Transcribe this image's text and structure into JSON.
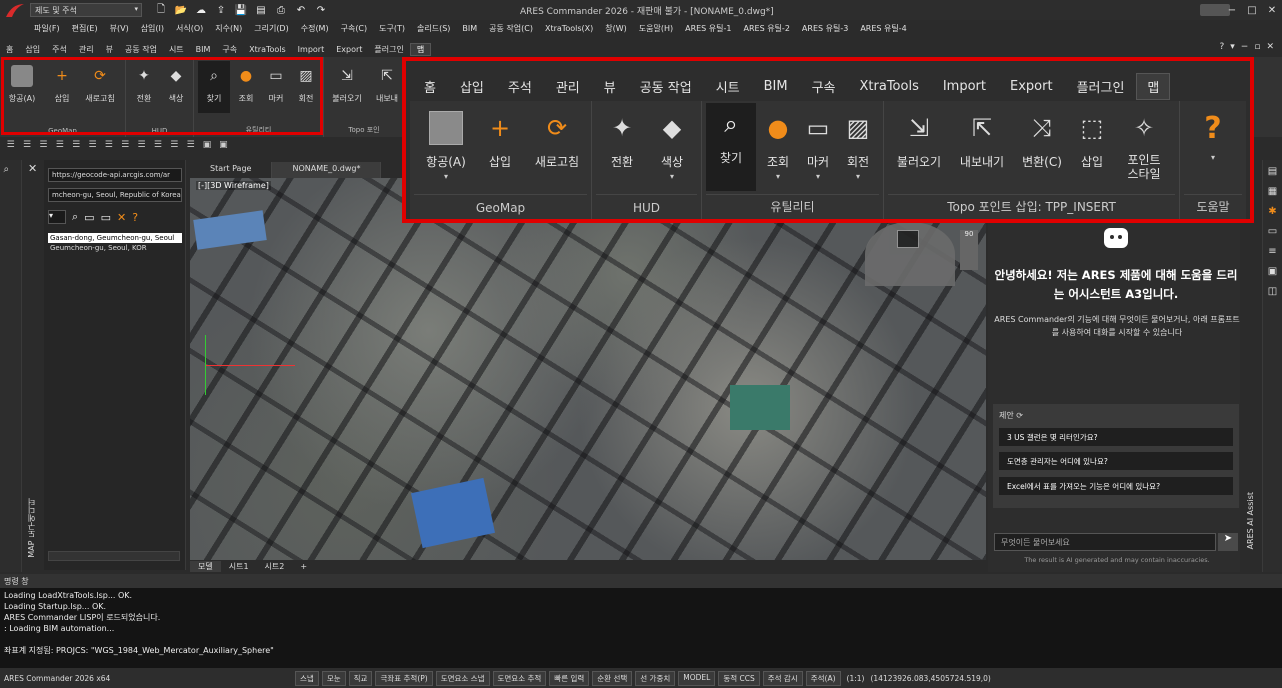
{
  "titlebar": {
    "workspace": "제도 및 주석",
    "title": "ARES Commander 2026 - 재판매 불가 - [NONAME_0.dwg*]",
    "minimize": "−",
    "maximize": "□",
    "close": "✕"
  },
  "menu": [
    "파일(F)",
    "편집(E)",
    "뷰(V)",
    "삽입(I)",
    "서식(O)",
    "지수(N)",
    "그리기(D)",
    "수정(M)",
    "구속(C)",
    "도구(T)",
    "솔리드(S)",
    "BIM",
    "공동 작업(C)",
    "XtraTools(X)",
    "창(W)",
    "도움말(H)",
    "ARES 유틸-1",
    "ARES 유틸-2",
    "ARES 유틸-3",
    "ARES 유틸-4"
  ],
  "ribbon_tabs": [
    "홈",
    "삽입",
    "주석",
    "관리",
    "뷰",
    "공동 작업",
    "시트",
    "BIM",
    "구속",
    "XtraTools",
    "Import",
    "Export",
    "플러그인",
    "맵"
  ],
  "ribbon_active": "맵",
  "small_ribbon": {
    "buttons": [
      "항공(A)",
      "삽입",
      "새로고침",
      "전환",
      "색상",
      "찾기",
      "조회",
      "마커",
      "회전",
      "불러오기",
      "내보내"
    ],
    "groups": [
      "GeoMap",
      "HUD",
      "유틸리티",
      "Topo 포인"
    ]
  },
  "zoomed_ribbon": {
    "tabs": [
      "홈",
      "삽입",
      "주석",
      "관리",
      "뷰",
      "공동 작업",
      "시트",
      "BIM",
      "구속",
      "XtraTools",
      "Import",
      "Export",
      "플러그인",
      "맵"
    ],
    "geomap": {
      "label": "GeoMap",
      "buttons": [
        "항공(A)",
        "삽입",
        "새로고침"
      ]
    },
    "hud": {
      "label": "HUD",
      "buttons": [
        "전환",
        "색상"
      ]
    },
    "utility": {
      "label": "유틸리티",
      "buttons": [
        "찾기",
        "조회",
        "마커",
        "회전"
      ]
    },
    "topo": {
      "label": "Topo 포인트 삽입: TPP_INSERT",
      "buttons": [
        "불러오기",
        "내보내기",
        "변환(C)",
        "삽입",
        "포인트\n스타일"
      ]
    },
    "help": {
      "label": "도움말"
    }
  },
  "map_panel": {
    "url": "https://geocode-api.arcgis.com/ar",
    "address": "mcheon-gu, Seoul, Republic of Korea",
    "results": [
      "Gasan-dong, Geumcheon-gu, Seoul",
      "Geumcheon-gu, Seoul, KOR"
    ],
    "vertical_label": "MAP 도구에디터"
  },
  "doc_tabs": [
    "Start Page",
    "NONAME_0.dwg*"
  ],
  "viewport_label": "[-][3D Wireframe]",
  "nav_90": "90",
  "sheet_tabs": [
    "모델",
    "시트1",
    "시트2",
    "+"
  ],
  "ai": {
    "heading": "안녕하세요! 저는 ARES 제품에 대해 도움을 드리는 어시스턴트 A3입니다.",
    "sub": "ARES Commander의 기능에 대해 무엇이든 물어보거나, 아래 프롬프트를 사용하여 대화를 시작할 수 있습니다",
    "suggest_title": "제안",
    "suggestions": [
      "3 US 갤런은 몇 리터인가요?",
      "도면층 관리자는 어디에 있나요?",
      "Excel에서 표를 가져오는 기능은 어디에 있나요?"
    ],
    "input_placeholder": "무엇이든 물어보세요",
    "disclaimer": "The result is AI generated and may contain inaccuracies.",
    "vertical_label": "ARES AI Assist"
  },
  "cmd": {
    "title": "명령 창",
    "lines": [
      "Loading LoadXtraTools.lsp... OK.",
      "Loading Startup.lsp... OK.",
      "ARES Commander LISP이 로드되었습니다.",
      ": Loading BIM automation...",
      "좌표계 지정됨: PROJCS: \"WGS_1984_Web_Mercator_Auxiliary_Sphere\""
    ]
  },
  "status": {
    "app": "ARES Commander 2026 x64",
    "buttons": [
      "스냅",
      "모눈",
      "직교",
      "극좌표 추적(P)",
      "도면요소 스냅",
      "도면요소 추적",
      "빠른 입력",
      "순환 선택",
      "선 가중치",
      "MODEL",
      "동적 CCS",
      "주석 감시",
      "주석(A)"
    ],
    "scale": "(1:1)",
    "coords": "(14123926.083,4505724.519,0)"
  }
}
